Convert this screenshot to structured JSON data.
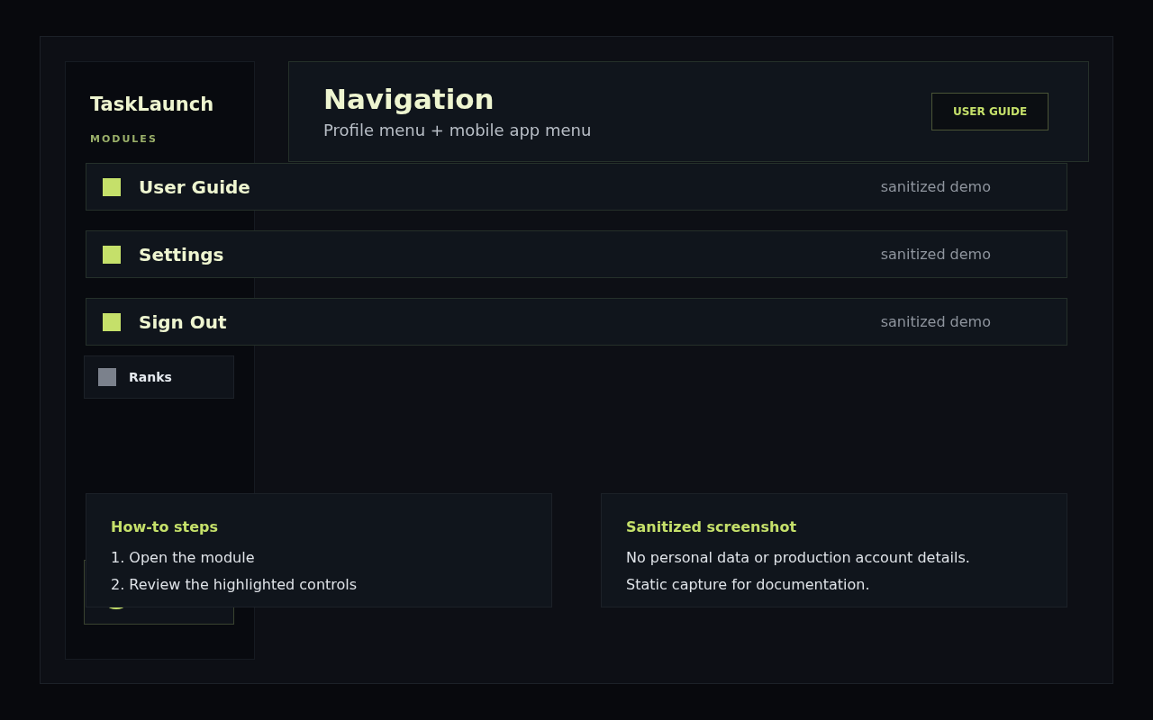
{
  "sidebar": {
    "brand": "TaskLaunch",
    "section_label": "MODULES",
    "items": [
      {
        "label": "Ranks",
        "selected": false
      }
    ]
  },
  "header": {
    "title": "Navigation",
    "subtitle": "Profile menu + mobile app menu",
    "button": "USER GUIDE"
  },
  "menu": [
    {
      "label": "User Guide",
      "note": "sanitized demo"
    },
    {
      "label": "Settings",
      "note": "sanitized demo"
    },
    {
      "label": "Sign Out",
      "note": "sanitized demo"
    }
  ],
  "cards": [
    {
      "title": "How-to steps",
      "lines": [
        "1. Open the module",
        "2. Review the highlighted controls"
      ]
    },
    {
      "title": "Sanitized screenshot",
      "lines": [
        "No personal data or production account details.",
        "Static capture for documentation."
      ]
    }
  ]
}
